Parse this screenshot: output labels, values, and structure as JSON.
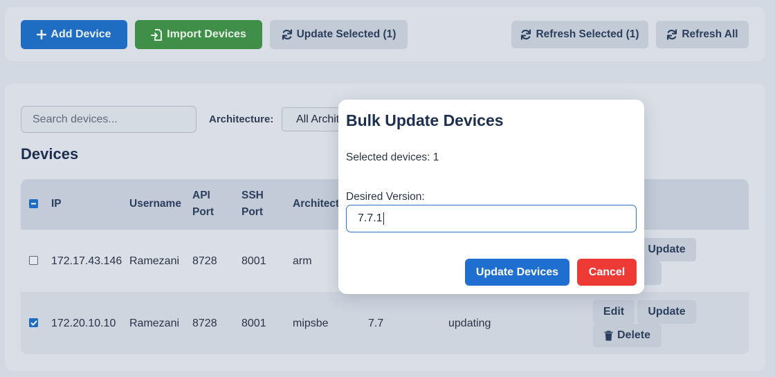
{
  "toolbar": {
    "add_device": "Add Device",
    "import_devices": "Import Devices",
    "update_selected": "Update Selected (1)",
    "refresh_selected": "Refresh Selected (1)",
    "refresh_all": "Refresh All"
  },
  "filters": {
    "search_placeholder": "Search devices...",
    "architecture_label": "Architecture:",
    "architecture_value": "All Architectures"
  },
  "devices": {
    "title": "Devices",
    "columns": {
      "ip": "IP",
      "username": "Username",
      "api_port_line1": "API",
      "api_port_line2": "Port",
      "ssh_port_line1": "SSH",
      "ssh_port_line2": "Port",
      "architecture": "Architecture"
    },
    "rows": [
      {
        "checked": false,
        "ip": "172.17.43.146",
        "username": "Ramezani",
        "api_port": "8728",
        "ssh_port": "8001",
        "architecture": "arm",
        "version": "",
        "status": ""
      },
      {
        "checked": true,
        "ip": "172.20.10.10",
        "username": "Ramezani",
        "api_port": "8728",
        "ssh_port": "8001",
        "architecture": "mipsbe",
        "version": "7.7",
        "status": "updating"
      }
    ],
    "actions": {
      "edit": "Edit",
      "update": "Update",
      "delete": "Delete"
    }
  },
  "modal": {
    "title": "Bulk Update Devices",
    "selected_text": "Selected devices: 1",
    "version_label": "Desired Version:",
    "version_value": "7.7.1",
    "update_button": "Update Devices",
    "cancel_button": "Cancel"
  },
  "colors": {
    "primary": "#1f6dc3",
    "success": "#3f8f48",
    "danger": "#ee3a34",
    "muted_button": "#c3cbd7"
  },
  "icons": {
    "add": "plus-icon",
    "import": "file-import-icon",
    "sync": "sync-icon",
    "delete": "trash-icon"
  }
}
